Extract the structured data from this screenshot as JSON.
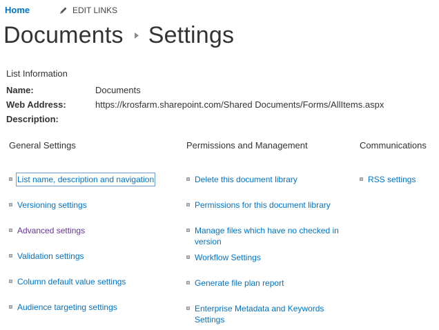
{
  "topbar": {
    "home": "Home",
    "edit_links": "EDIT LINKS"
  },
  "title": {
    "part1": "Documents",
    "part2": "Settings"
  },
  "info": {
    "heading": "List Information",
    "name_label": "Name:",
    "name_value": "Documents",
    "web_label": "Web Address:",
    "web_value": "https://krosfarm.sharepoint.com/Shared Documents/Forms/AllItems.aspx",
    "desc_label": "Description:",
    "desc_value": ""
  },
  "columns": {
    "general": {
      "heading": "General Settings",
      "items": [
        "List name, description and navigation",
        "Versioning settings",
        "Advanced settings",
        "Validation settings",
        "Column default value settings",
        "Audience targeting settings"
      ]
    },
    "permissions": {
      "heading": "Permissions and Management",
      "items": [
        "Delete this document library",
        "Permissions for this document library",
        "Manage files which have no checked in version",
        "Workflow Settings",
        "Generate file plan report",
        "Enterprise Metadata and Keywords Settings"
      ]
    },
    "communications": {
      "heading": "Communications",
      "items": [
        "RSS settings"
      ]
    }
  },
  "colors": {
    "link": "#0072c6",
    "visited": "#663399",
    "text": "#333333"
  }
}
